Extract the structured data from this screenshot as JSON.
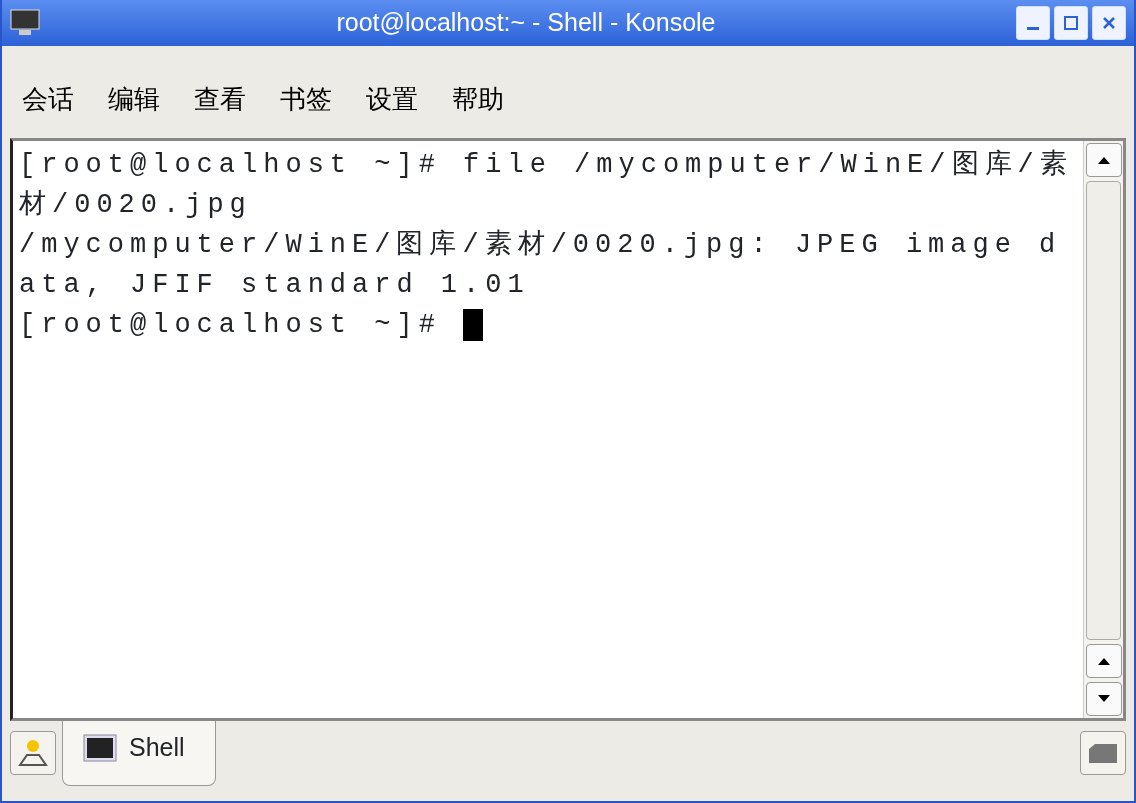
{
  "window": {
    "title": "root@localhost:~ - Shell - Konsole"
  },
  "menu": [
    "会话",
    "编辑",
    "查看",
    "书签",
    "设置",
    "帮助"
  ],
  "terminal": {
    "lines": [
      "[root@localhost ~]# file /mycomputer/WinE/图库/素",
      "材/0020.jpg",
      "/mycomputer/WinE/图库/素材/0020.jpg: JPEG image d",
      "ata, JFIF standard 1.01"
    ],
    "prompt": "[root@localhost ~]# "
  },
  "tabs": [
    {
      "label": "Shell",
      "selected": true
    }
  ]
}
